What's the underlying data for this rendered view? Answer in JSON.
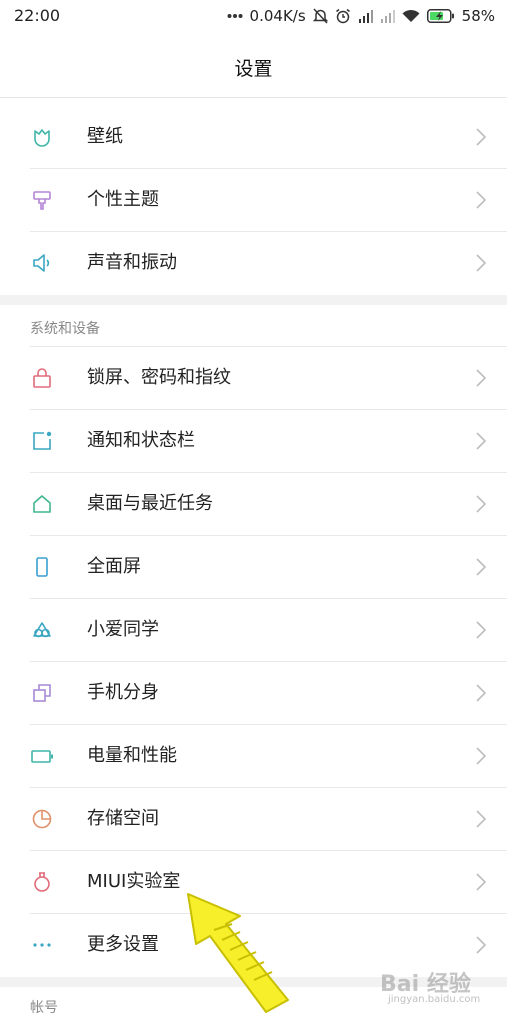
{
  "status_bar": {
    "time": "22:00",
    "speed": "0.04K/s",
    "battery": "58%",
    "icons": [
      "more-dots-icon",
      "mute-bell-icon",
      "alarm-icon",
      "signal-icon",
      "signal-icon",
      "wifi-icon",
      "battery-icon"
    ]
  },
  "header": {
    "title": "设置"
  },
  "rows": [
    {
      "label": "壁纸",
      "icon": "wallpaper-icon",
      "color": "#3fb6a8"
    },
    {
      "label": "个性主题",
      "icon": "theme-brush-icon",
      "color": "#b486d6"
    },
    {
      "label": "声音和振动",
      "icon": "speaker-icon",
      "color": "#3aa7c2"
    },
    {
      "label": "锁屏、密码和指纹",
      "icon": "lock-icon",
      "color": "#e06b7a"
    },
    {
      "label": "通知和状态栏",
      "icon": "notification-icon",
      "color": "#3aa7c2"
    },
    {
      "label": "桌面与最近任务",
      "icon": "home-icon",
      "color": "#3fb690"
    },
    {
      "label": "全面屏",
      "icon": "fullscreen-phone-icon",
      "color": "#3a9fd0"
    },
    {
      "label": "小爱同学",
      "icon": "xiaoai-icon",
      "color": "#3aa7c2"
    },
    {
      "label": "手机分身",
      "icon": "dual-space-icon",
      "color": "#a68ad6"
    },
    {
      "label": "电量和性能",
      "icon": "battery-perf-icon",
      "color": "#3fb6a8"
    },
    {
      "label": "存储空间",
      "icon": "storage-pie-icon",
      "color": "#e0906a"
    },
    {
      "label": "MIUI实验室",
      "icon": "lab-flask-icon",
      "color": "#e06b7a"
    },
    {
      "label": "更多设置",
      "icon": "more-icon",
      "color": "#3aa7c2"
    }
  ],
  "sections": {
    "system": "系统和设备",
    "account": "帐号"
  },
  "watermark": {
    "text": "Bai 经验",
    "sub": "jingyan.baidu.com"
  }
}
